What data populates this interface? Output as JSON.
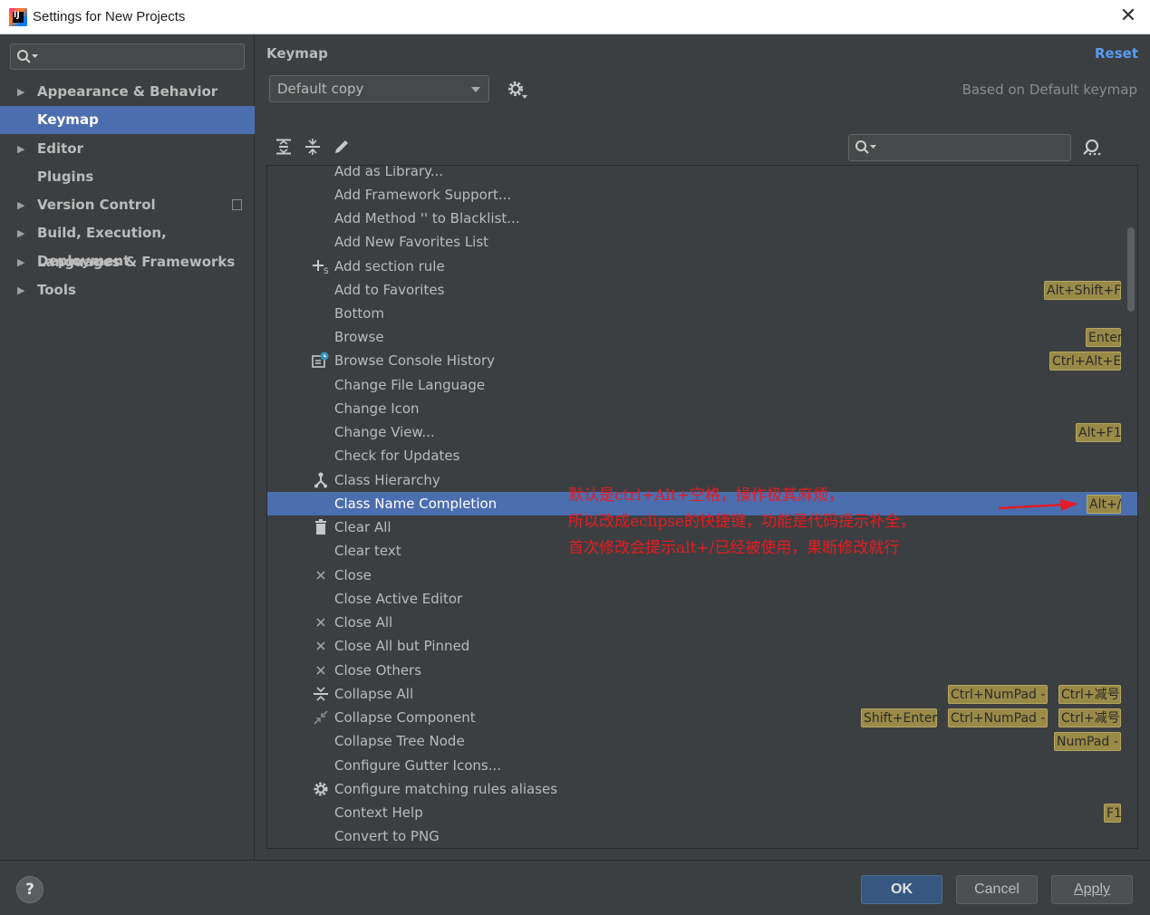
{
  "window": {
    "title": "Settings for New Projects",
    "app_icon_text": "IJ"
  },
  "sidebar": {
    "search": {
      "placeholder": "",
      "value": ""
    },
    "items": [
      {
        "label": "Appearance & Behavior",
        "expandable": true
      },
      {
        "label": "Keymap",
        "expandable": false,
        "selected": true
      },
      {
        "label": "Editor",
        "expandable": true
      },
      {
        "label": "Plugins",
        "expandable": false
      },
      {
        "label": "Version Control",
        "expandable": true
      },
      {
        "label": "Build, Execution, Deployment",
        "expandable": true
      },
      {
        "label": "Languages & Frameworks",
        "expandable": true
      },
      {
        "label": "Tools",
        "expandable": true
      }
    ]
  },
  "main": {
    "title": "Keymap",
    "reset_label": "Reset",
    "keymap_select": "Default copy",
    "based_on": "Based on Default keymap",
    "filter": {
      "value": ""
    },
    "actions": [
      {
        "label": "Add as Library...",
        "icon": "",
        "shortcuts": []
      },
      {
        "label": "Add Framework Support...",
        "icon": "",
        "shortcuts": []
      },
      {
        "label": "Add Method '' to Blacklist...",
        "icon": "",
        "shortcuts": []
      },
      {
        "label": "Add New Favorites List",
        "icon": "",
        "shortcuts": []
      },
      {
        "label": "Add section rule",
        "icon": "add-section-rule-icon",
        "shortcuts": []
      },
      {
        "label": "Add to Favorites",
        "icon": "",
        "shortcuts": [
          "Alt+Shift+F"
        ]
      },
      {
        "label": "Bottom",
        "icon": "",
        "shortcuts": []
      },
      {
        "label": "Browse",
        "icon": "",
        "shortcuts": [
          "Enter"
        ]
      },
      {
        "label": "Browse Console History",
        "icon": "console-history-icon",
        "shortcuts": [
          "Ctrl+Alt+E"
        ]
      },
      {
        "label": "Change File Language",
        "icon": "",
        "shortcuts": []
      },
      {
        "label": "Change Icon",
        "icon": "",
        "shortcuts": []
      },
      {
        "label": "Change View...",
        "icon": "",
        "shortcuts": [
          "Alt+F1"
        ]
      },
      {
        "label": "Check for Updates",
        "icon": "",
        "shortcuts": []
      },
      {
        "label": "Class Hierarchy",
        "icon": "class-hierarchy-icon",
        "shortcuts": []
      },
      {
        "label": "Class Name Completion",
        "icon": "",
        "shortcuts": [
          "Alt+/"
        ],
        "selected": true
      },
      {
        "label": "Clear All",
        "icon": "trash-icon",
        "shortcuts": []
      },
      {
        "label": "Clear text",
        "icon": "",
        "shortcuts": []
      },
      {
        "label": "Close",
        "icon": "close-icon",
        "shortcuts": []
      },
      {
        "label": "Close Active Editor",
        "icon": "",
        "shortcuts": []
      },
      {
        "label": "Close All",
        "icon": "close-icon",
        "shortcuts": []
      },
      {
        "label": "Close All but Pinned",
        "icon": "close-icon",
        "shortcuts": []
      },
      {
        "label": "Close Others",
        "icon": "close-icon",
        "shortcuts": []
      },
      {
        "label": "Collapse All",
        "icon": "collapse-all-icon",
        "shortcuts": [
          "Ctrl+NumPad -",
          "Ctrl+减号"
        ]
      },
      {
        "label": "Collapse Component",
        "icon": "collapse-component-icon",
        "shortcuts": [
          "Shift+Enter",
          "Ctrl+NumPad -",
          "Ctrl+减号"
        ]
      },
      {
        "label": "Collapse Tree Node",
        "icon": "",
        "shortcuts": [
          "NumPad -"
        ]
      },
      {
        "label": "Configure Gutter Icons...",
        "icon": "",
        "shortcuts": []
      },
      {
        "label": "Configure matching rules aliases",
        "icon": "gear-icon",
        "shortcuts": []
      },
      {
        "label": "Context Help",
        "icon": "",
        "shortcuts": [
          "F1"
        ]
      },
      {
        "label": "Convert to PNG",
        "icon": "",
        "shortcuts": []
      }
    ]
  },
  "annotation": {
    "lines": [
      "默认是ctrl+Alt+空格，操作极其麻烦，",
      "所以改成eclipse的快捷键，功能是代码提示补全，",
      "首次修改会提示alt+/已经被使用，果断修改就行"
    ],
    "color": "#e51c23"
  },
  "footer": {
    "help_label": "?",
    "ok_label": "OK",
    "cancel_label": "Cancel",
    "apply_label": "Apply"
  },
  "colors": {
    "selection": "#4b6eaf",
    "link": "#589df6",
    "shortcut_badge": "#9a8a47",
    "ok_button": "#365880"
  }
}
